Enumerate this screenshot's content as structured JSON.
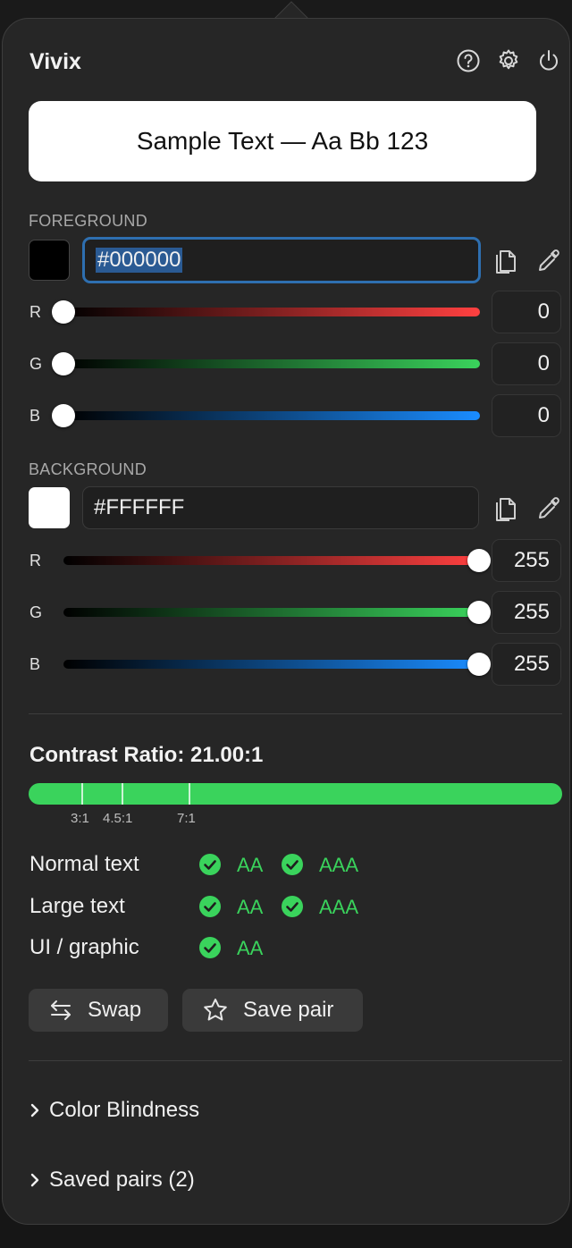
{
  "app": {
    "title": "Vivix"
  },
  "header_icons": [
    "help-icon",
    "gear-icon",
    "power-icon"
  ],
  "sample": {
    "text": "Sample Text — Aa Bb 123"
  },
  "foreground": {
    "label": "FOREGROUND",
    "hex": "#000000",
    "swatch_color": "#000000",
    "channels": [
      {
        "label": "R",
        "value": "0",
        "level": 0,
        "color": "#ff4040"
      },
      {
        "label": "G",
        "value": "0",
        "level": 0,
        "color": "#3ad35c"
      },
      {
        "label": "B",
        "value": "0",
        "level": 0,
        "color": "#1a8cff"
      }
    ]
  },
  "background": {
    "label": "BACKGROUND",
    "hex": "#FFFFFF",
    "swatch_color": "#FFFFFF",
    "channels": [
      {
        "label": "R",
        "value": "255",
        "level": 255,
        "color": "#ff4040"
      },
      {
        "label": "G",
        "value": "255",
        "level": 255,
        "color": "#3ad35c"
      },
      {
        "label": "B",
        "value": "255",
        "level": 255,
        "color": "#1a8cff"
      }
    ]
  },
  "contrast": {
    "title": "Contrast Ratio: 21.00:1",
    "ticks": [
      "3:1",
      "4.5:1",
      "7:1"
    ],
    "bar_color": "#3ad35c",
    "rows": [
      {
        "label": "Normal text",
        "levels": [
          "AA",
          "AAA"
        ]
      },
      {
        "label": "Large text",
        "levels": [
          "AA",
          "AAA"
        ]
      },
      {
        "label": "UI / graphic",
        "levels": [
          "AA"
        ]
      }
    ]
  },
  "actions": {
    "swap": "Swap",
    "save_pair": "Save pair"
  },
  "sections": {
    "color_blindness": "Color Blindness",
    "saved_pairs": "Saved pairs (2)"
  }
}
